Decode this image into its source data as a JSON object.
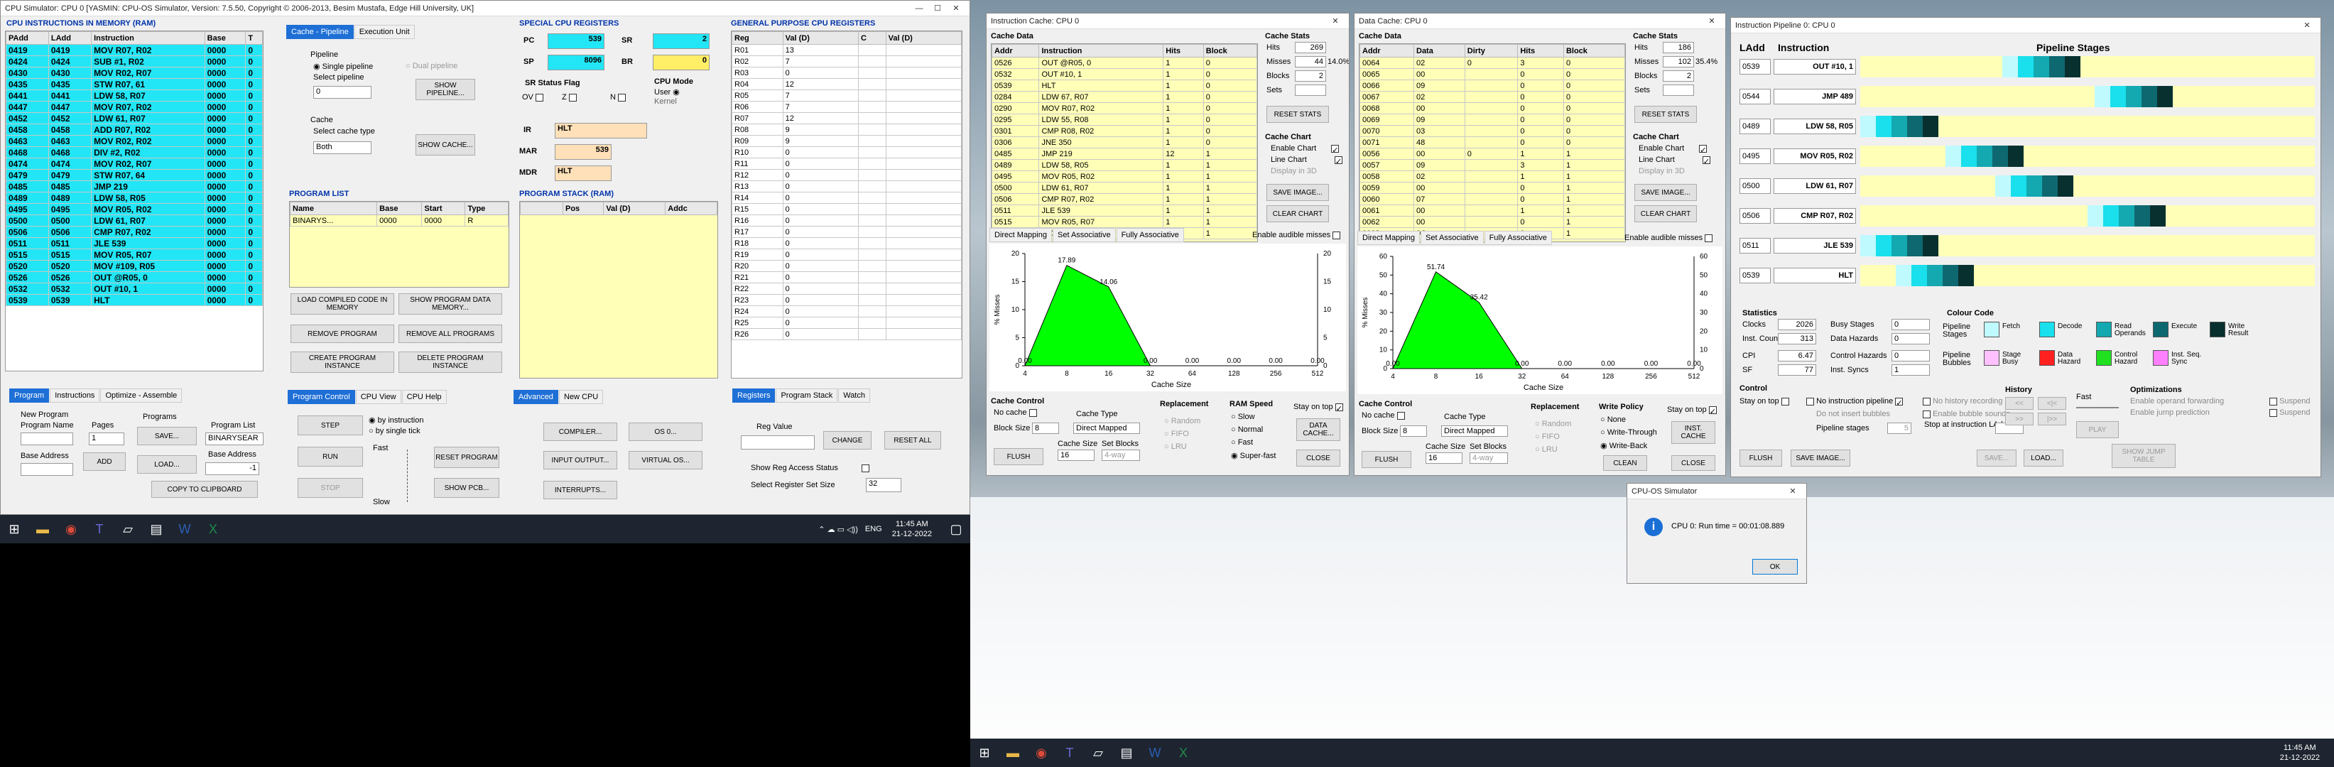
{
  "main_window": {
    "title": "CPU Simulator: CPU 0   [YASMIN: CPU-OS Simulator,  Version: 7.5.50,  Copyright © 2006-2013, Besim Mustafa, Edge Hill University, UK]",
    "memory_title": "CPU INSTRUCTIONS IN MEMORY (RAM)",
    "memory_headers": [
      "PAdd",
      "LAdd",
      "Instruction",
      "Base",
      "T"
    ],
    "memory_rows": [
      [
        "0419",
        "0419",
        "MOV R07, R02",
        "0000",
        "0"
      ],
      [
        "0424",
        "0424",
        "SUB #1, R02",
        "0000",
        "0"
      ],
      [
        "0430",
        "0430",
        "MOV R02, R07",
        "0000",
        "0"
      ],
      [
        "0435",
        "0435",
        "STW R07, 61",
        "0000",
        "0"
      ],
      [
        "0441",
        "0441",
        "LDW 58, R07",
        "0000",
        "0"
      ],
      [
        "0447",
        "0447",
        "MOV R07, R02",
        "0000",
        "0"
      ],
      [
        "0452",
        "0452",
        "LDW 61, R07",
        "0000",
        "0"
      ],
      [
        "0458",
        "0458",
        "ADD R07, R02",
        "0000",
        "0"
      ],
      [
        "0463",
        "0463",
        "MOV R02, R02",
        "0000",
        "0"
      ],
      [
        "0468",
        "0468",
        "DIV #2, R02",
        "0000",
        "0"
      ],
      [
        "0474",
        "0474",
        "MOV R02, R07",
        "0000",
        "0"
      ],
      [
        "0479",
        "0479",
        "STW R07, 64",
        "0000",
        "0"
      ],
      [
        "0485",
        "0485",
        "JMP 219",
        "0000",
        "0"
      ],
      [
        "0489",
        "0489",
        "LDW 58, R05",
        "0000",
        "0"
      ],
      [
        "0495",
        "0495",
        "MOV R05, R02",
        "0000",
        "0"
      ],
      [
        "0500",
        "0500",
        "LDW 61, R07",
        "0000",
        "0"
      ],
      [
        "0506",
        "0506",
        "CMP R07, R02",
        "0000",
        "0"
      ],
      [
        "0511",
        "0511",
        "JLE 539",
        "0000",
        "0"
      ],
      [
        "0515",
        "0515",
        "MOV R05, R07",
        "0000",
        "0"
      ],
      [
        "0520",
        "0520",
        "MOV #109, R05",
        "0000",
        "0"
      ],
      [
        "0526",
        "0526",
        "OUT @R05, 0",
        "0000",
        "0"
      ],
      [
        "0532",
        "0532",
        "OUT #10, 1",
        "0000",
        "0"
      ],
      [
        "0539",
        "0539",
        "HLT",
        "0000",
        "0"
      ]
    ],
    "left_tabs": [
      "Program",
      "Instructions",
      "Optimize - Assemble"
    ],
    "new_program_label": "New Program",
    "program_name_label": "Program Name",
    "pages_label": "Pages",
    "pages_value": "1",
    "programs_label": "Programs",
    "base_address_label": "Base Address",
    "save_btn": "SAVE...",
    "add_btn": "ADD",
    "load_btn": "LOAD...",
    "program_list_label": "Program List",
    "program_list_value": "BINARYSEAR",
    "base_address2_label": "Base Address",
    "base_address2_value": "-1",
    "copy_clipboard": "COPY TO CLIPBOARD",
    "cache_tabs": [
      "Cache - Pipeline",
      "Execution Unit"
    ],
    "pipeline_label": "Pipeline",
    "single_pipeline": "Single pipeline",
    "dual_pipeline": "Dual pipeline",
    "select_pipeline": "Select pipeline",
    "select_pipeline_value": "0",
    "show_pipeline": "SHOW PIPELINE...",
    "cache_label": "Cache",
    "select_cache_type": "Select cache type",
    "cache_type_value": "Both",
    "show_cache": "SHOW CACHE...",
    "program_list_title": "PROGRAM LIST",
    "program_list_headers": [
      "Name",
      "Base",
      "Start",
      "Type"
    ],
    "program_list_row": [
      "BINARYS...",
      "0000",
      "0000",
      "R"
    ],
    "load_compiled": "LOAD COMPILED CODE IN MEMORY",
    "show_program_data": "SHOW PROGRAM DATA MEMORY...",
    "remove_program": "REMOVE PROGRAM",
    "remove_all_programs": "REMOVE ALL PROGRAMS",
    "create_instance": "CREATE PROGRAM INSTANCE",
    "delete_instance": "DELETE PROGRAM INSTANCE",
    "ctrl_tabs": [
      "Program Control",
      "CPU View",
      "CPU Help"
    ],
    "step_btn": "STEP",
    "run_btn": "RUN",
    "stop_btn": "STOP",
    "by_instruction": "by instruction",
    "by_single_tick": "by single tick",
    "fast_label": "Fast",
    "slow_label": "Slow",
    "reset_program": "RESET PROGRAM",
    "show_pcb": "SHOW PCB...",
    "adv_tabs": [
      "Advanced",
      "New CPU"
    ],
    "compiler_btn": "COMPILER...",
    "os_btn": "OS 0...",
    "io_btn": "INPUT OUTPUT...",
    "vos_btn": "VIRTUAL OS...",
    "interrupts_btn": "INTERRUPTS...",
    "special_title": "SPECIAL CPU REGISTERS",
    "pc_label": "PC",
    "pc_value": "539",
    "sr_label": "SR",
    "sr_value": "2",
    "sp_label": "SP",
    "sp_value": "8096",
    "br_label": "BR",
    "br_value": "0",
    "sr_flags_label": "SR Status Flag",
    "flag_ov": "OV",
    "flag_z": "Z",
    "flag_n": "N",
    "cpu_mode": "CPU Mode",
    "mode_user": "User",
    "mode_kernel": "Kernel",
    "ir_label": "IR",
    "ir_value": "HLT",
    "mar_label": "MAR",
    "mar_value": "539",
    "mdr_label": "MDR",
    "mdr_value": "HLT",
    "stack_title": "PROGRAM STACK (RAM)",
    "stack_headers": [
      "Pos",
      "Val (D)",
      "Addc"
    ],
    "gp_title": "GENERAL PURPOSE CPU REGISTERS",
    "gp_headers": [
      "Reg",
      "Val (D)",
      "C",
      "Val (D)"
    ],
    "gp_rows": [
      [
        "R01",
        "13"
      ],
      [
        "R02",
        "7"
      ],
      [
        "R03",
        "0"
      ],
      [
        "R04",
        "12"
      ],
      [
        "R05",
        "7"
      ],
      [
        "R06",
        "7"
      ],
      [
        "R07",
        "12"
      ],
      [
        "R08",
        "9"
      ],
      [
        "R09",
        "9"
      ],
      [
        "R10",
        "0"
      ],
      [
        "R11",
        "0"
      ],
      [
        "R12",
        "0"
      ],
      [
        "R13",
        "0"
      ],
      [
        "R14",
        "0"
      ],
      [
        "R15",
        "0"
      ],
      [
        "R16",
        "0"
      ],
      [
        "R17",
        "0"
      ],
      [
        "R18",
        "0"
      ],
      [
        "R19",
        "0"
      ],
      [
        "R20",
        "0"
      ],
      [
        "R21",
        "0"
      ],
      [
        "R22",
        "0"
      ],
      [
        "R23",
        "0"
      ],
      [
        "R24",
        "0"
      ],
      [
        "R25",
        "0"
      ],
      [
        "R26",
        "0"
      ]
    ],
    "reg_tabs": [
      "Registers",
      "Program Stack",
      "Watch"
    ],
    "reg_value_label": "Reg Value",
    "change_btn": "CHANGE",
    "reset_all_btn": "RESET ALL",
    "show_reg_access": "Show Reg Access Status",
    "select_reg_set": "Select Register Set Size",
    "reg_set_value": "32"
  },
  "icache": {
    "title": "Instruction Cache: CPU 0",
    "data_label": "Cache Data",
    "headers": [
      "Addr",
      "Instruction",
      "Hits",
      "Block"
    ],
    "rows": [
      [
        "0526",
        "OUT @R05, 0",
        "1",
        "0"
      ],
      [
        "0532",
        "OUT #10, 1",
        "1",
        "0"
      ],
      [
        "0539",
        "HLT",
        "1",
        "0"
      ],
      [
        "0284",
        "LDW 67, R07",
        "1",
        "0"
      ],
      [
        "0290",
        "MOV R07, R02",
        "1",
        "0"
      ],
      [
        "0295",
        "LDW 55, R08",
        "1",
        "0"
      ],
      [
        "0301",
        "CMP R08, R02",
        "1",
        "0"
      ],
      [
        "0306",
        "JNE 350",
        "1",
        "0"
      ],
      [
        "0485",
        "JMP 219",
        "12",
        "1"
      ],
      [
        "0489",
        "LDW 58, R05",
        "1",
        "1"
      ],
      [
        "0495",
        "MOV R05, R02",
        "1",
        "1"
      ],
      [
        "0500",
        "LDW 61, R07",
        "1",
        "1"
      ],
      [
        "0506",
        "CMP R07, R02",
        "1",
        "1"
      ],
      [
        "0511",
        "JLE 539",
        "1",
        "1"
      ],
      [
        "0515",
        "MOV R05, R07",
        "1",
        "1"
      ],
      [
        "0520",
        "MOV #109, R05",
        "1",
        "1"
      ]
    ],
    "stats_label": "Cache Stats",
    "hits_label": "Hits",
    "hits_value": "269",
    "misses_label": "Misses",
    "misses_value": "44",
    "miss_pct": "14.0%",
    "blocks_label": "Blocks",
    "blocks_value": "2",
    "sets_label": "Sets",
    "sets_value": "",
    "reset_stats": "RESET STATS",
    "chart_label": "Cache Chart",
    "enable_chart": "Enable Chart",
    "line_chart": "Line Chart",
    "display_3d": "Display in 3D",
    "save_image": "SAVE IMAGE...",
    "clear_chart": "CLEAR CHART",
    "chart_tabs": [
      "Direct Mapping",
      "Set Associative",
      "Fully Associative"
    ],
    "audible": "Enable audible misses",
    "ctrl_label": "Cache Control",
    "no_cache": "No cache",
    "block_size_label": "Block Size",
    "block_size": "8",
    "cache_type_label": "Cache Type",
    "cache_type": "Direct Mapped",
    "cache_size_label": "Cache Size",
    "cache_size": "16",
    "set_blocks_label": "Set Blocks",
    "set_blocks": "4-way",
    "replacement_label": "Replacement",
    "rep_random": "Random",
    "rep_fifo": "FIFO",
    "rep_lru": "LRU",
    "ram_speed_label": "RAM Speed",
    "sp_slow": "Slow",
    "sp_normal": "Normal",
    "sp_fast": "Fast",
    "sp_super": "Super-fast",
    "stay_on_top": "Stay on top",
    "data_cache_btn": "DATA CACHE...",
    "flush": "FLUSH",
    "close": "CLOSE"
  },
  "dcache": {
    "title": "Data Cache: CPU 0",
    "data_label": "Cache Data",
    "headers": [
      "Addr",
      "Data",
      "Dirty",
      "Hits",
      "Block"
    ],
    "rows": [
      [
        "0064",
        "02",
        "0",
        "3",
        "0"
      ],
      [
        "0065",
        "00",
        "",
        "0",
        "0"
      ],
      [
        "0066",
        "09",
        "",
        "0",
        "0"
      ],
      [
        "0067",
        "02",
        "",
        "0",
        "0"
      ],
      [
        "0068",
        "00",
        "",
        "0",
        "0"
      ],
      [
        "0069",
        "09",
        "",
        "0",
        "0"
      ],
      [
        "0070",
        "03",
        "",
        "0",
        "0"
      ],
      [
        "0071",
        "48",
        "",
        "0",
        "0"
      ],
      [
        "0056",
        "00",
        "0",
        "1",
        "1"
      ],
      [
        "0057",
        "09",
        "",
        "3",
        "1"
      ],
      [
        "0058",
        "02",
        "",
        "1",
        "1"
      ],
      [
        "0059",
        "00",
        "",
        "0",
        "1"
      ],
      [
        "0060",
        "07",
        "",
        "0",
        "1"
      ],
      [
        "0061",
        "00",
        "",
        "1",
        "1"
      ],
      [
        "0062",
        "00",
        "",
        "0",
        "1"
      ],
      [
        "0063",
        "0C",
        "",
        "0",
        "1"
      ]
    ],
    "stats_label": "Cache Stats",
    "hits_label": "Hits",
    "hits_value": "186",
    "misses_label": "Misses",
    "misses_value": "102",
    "miss_pct": "35.4%",
    "blocks_label": "Blocks",
    "blocks_value": "2",
    "sets_label": "Sets",
    "sets_value": "",
    "reset_stats": "RESET STATS",
    "chart_label": "Cache Chart",
    "enable_chart": "Enable Chart",
    "line_chart": "Line Chart",
    "display_3d": "Display in 3D",
    "save_image": "SAVE IMAGE...",
    "clear_chart": "CLEAR CHART",
    "chart_tabs": [
      "Direct Mapping",
      "Set Associative",
      "Fully Associative"
    ],
    "audible": "Enable audible misses",
    "ctrl_label": "Cache Control",
    "no_cache": "No cache",
    "block_size_label": "Block Size",
    "block_size": "8",
    "cache_type_label": "Cache Type",
    "cache_type": "Direct Mapped",
    "cache_size_label": "Cache Size",
    "cache_size": "16",
    "set_blocks_label": "Set Blocks",
    "set_blocks": "4-way",
    "replacement_label": "Replacement",
    "rep_random": "Random",
    "rep_fifo": "FIFO",
    "rep_lru": "LRU",
    "write_policy_label": "Write Policy",
    "wp_none": "None",
    "wp_through": "Write-Through",
    "wp_back": "Write-Back",
    "stay_on_top": "Stay on top",
    "inst_cache_btn": "INST. CACHE",
    "flush": "FLUSH",
    "clean": "CLEAN",
    "close": "CLOSE"
  },
  "pipeline": {
    "title": "Instruction Pipeline 0: CPU 0",
    "ladd_header": "LAdd",
    "instr_header": "Instruction",
    "stages_header": "Pipeline Stages",
    "rows": [
      [
        "0539",
        "OUT #10, 1"
      ],
      [
        "0544",
        "JMP 489"
      ],
      [
        "0489",
        "LDW 58, R05"
      ],
      [
        "0495",
        "MOV R05, R02"
      ],
      [
        "0500",
        "LDW 61, R07"
      ],
      [
        "0506",
        "CMP R07, R02"
      ],
      [
        "0511",
        "JLE 539"
      ],
      [
        "0539",
        "HLT"
      ]
    ],
    "stats_label": "Statistics",
    "clocks_label": "Clocks",
    "clocks": "2026",
    "inst_count_label": "Inst. Count",
    "inst_count": "313",
    "cpi_label": "CPI",
    "cpi": "6.47",
    "sf_label": "SF",
    "sf": "77",
    "busy_label": "Busy Stages",
    "busy": "0",
    "data_haz_label": "Data Hazards",
    "data_haz": "0",
    "ctrl_haz_label": "Control Hazards",
    "ctrl_haz": "0",
    "inst_sync_label": "Inst. Syncs",
    "inst_sync": "1",
    "colour_code_label": "Colour Code",
    "pipeline_stages_label": "Pipeline Stages",
    "pipeline_bubbles_label": "Pipeline Bubbles",
    "legend": [
      [
        "Fetch",
        "#bffaff"
      ],
      [
        "Decode",
        "#19e0ec"
      ],
      [
        "Read Operands",
        "#14a8b0"
      ],
      [
        "Execute",
        "#0e6870"
      ],
      [
        "Write Result",
        "#08302f"
      ],
      [
        "Stage Busy",
        "#ffc0ff"
      ],
      [
        "Data Hazard",
        "#ff2020"
      ],
      [
        "Control Hazard",
        "#20e020"
      ],
      [
        "Inst. Seq. Sync",
        "#ff80ff"
      ]
    ],
    "control_label": "Control",
    "stay_on_top": "Stay on top",
    "no_instr_pipeline": "No instruction pipeline",
    "no_history": "No history recording",
    "no_bubbles": "Do not insert bubbles",
    "enable_bubble_sounds": "Enable bubble sounds",
    "pipe_stages_label": "Pipeline stages",
    "pipe_stages": "5",
    "stop_at_label": "Stop at instruction LAdd",
    "history_label": "History",
    "fast_label": "Fast",
    "play_btn": "PLAY",
    "optim_label": "Optimizations",
    "opt1": "Enable operand forwarding",
    "opt2": "Enable jump prediction",
    "suspend1": "Suspend",
    "suspend2": "Suspend",
    "flush": "FLUSH",
    "save_image": "SAVE IMAGE...",
    "save": "SAVE...",
    "load": "LOAD...",
    "show_jump": "SHOW JUMP TABLE"
  },
  "dialog": {
    "title": "CPU-OS Simulator",
    "message": "CPU 0: Run time = 00:01:08.889",
    "ok": "OK"
  },
  "taskbar_left": {
    "lang": "ENG",
    "time": "11:45 AM",
    "date": "21-12-2022"
  },
  "taskbar_right": {
    "time": "11:45 AM",
    "date": "21-12-2022"
  },
  "chart_data": [
    {
      "type": "area",
      "title": "",
      "xlabel": "Cache Size",
      "ylabel": "% Misses",
      "categories": [
        "4",
        "8",
        "16",
        "32",
        "64",
        "128",
        "256",
        "512"
      ],
      "values": [
        0.0,
        17.89,
        14.06,
        0.0,
        0.0,
        0.0,
        0.0,
        0.0
      ],
      "data_labels": [
        "0.00",
        "17.89",
        "14.06",
        "0.00",
        "0.00",
        "0.00",
        "0.00",
        "0.00"
      ],
      "ylim": [
        0,
        20
      ],
      "y_ticks": [
        "0",
        "5",
        "10",
        "15",
        "20"
      ],
      "y2_ticks": [
        "0",
        "5",
        "10",
        "15",
        "20"
      ]
    },
    {
      "type": "area",
      "title": "",
      "xlabel": "Cache Size",
      "ylabel": "% Misses",
      "categories": [
        "4",
        "8",
        "16",
        "32",
        "64",
        "128",
        "256",
        "512"
      ],
      "values": [
        0.0,
        51.74,
        35.42,
        0.0,
        0.0,
        0.0,
        0.0,
        0.0
      ],
      "data_labels": [
        "0.00",
        "51.74",
        "35.42",
        "0.00",
        "0.00",
        "0.00",
        "0.00",
        "0.00"
      ],
      "ylim": [
        0,
        60
      ],
      "y_ticks": [
        "0",
        "10",
        "20",
        "30",
        "40",
        "50",
        "60"
      ],
      "y2_ticks": [
        "0",
        "10",
        "20",
        "30",
        "40",
        "50",
        "60"
      ]
    }
  ]
}
